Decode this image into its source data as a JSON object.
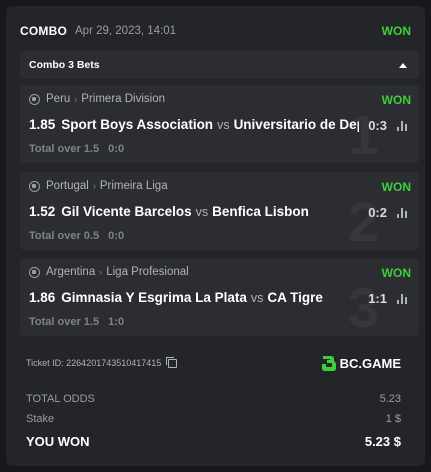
{
  "header": {
    "type": "COMBO",
    "date": "Apr 29, 2023, 14:01",
    "status": "WON"
  },
  "combo": {
    "label": "Combo 3 Bets"
  },
  "bets": [
    {
      "index": "1",
      "country": "Peru",
      "league": "Primera Division",
      "status": "WON",
      "odds": "1.85",
      "home": "Sport Boys Association",
      "vs": "vs",
      "away": "Universitario de Deportes",
      "score": "0:3",
      "market": "Total over 1.5",
      "result": "0:0"
    },
    {
      "index": "2",
      "country": "Portugal",
      "league": "Primeira Liga",
      "status": "WON",
      "odds": "1.52",
      "home": "Gil Vicente Barcelos",
      "vs": "vs",
      "away": "Benfica Lisbon",
      "score": "0:2",
      "market": "Total over 0.5",
      "result": "0:0"
    },
    {
      "index": "3",
      "country": "Argentina",
      "league": "Liga Profesional",
      "status": "WON",
      "odds": "1.86",
      "home": "Gimnasia Y Esgrima La Plata",
      "vs": "vs",
      "away": "CA Tigre",
      "score": "1:1",
      "market": "Total over 1.5",
      "result": "1:0"
    }
  ],
  "ticket": {
    "id": "Ticket ID: 2264201743510417415"
  },
  "brand": {
    "name": "BC.GAME"
  },
  "summary": {
    "total_odds_label": "TOTAL ODDS",
    "total_odds_value": "5.23",
    "stake_label": "Stake",
    "stake_value": "1 $",
    "won_label": "YOU WON",
    "won_value": "5.23 $"
  },
  "colors": {
    "won_green": "#3ccf3c",
    "card_bg": "#232528",
    "row_bg": "#2b2d31"
  }
}
